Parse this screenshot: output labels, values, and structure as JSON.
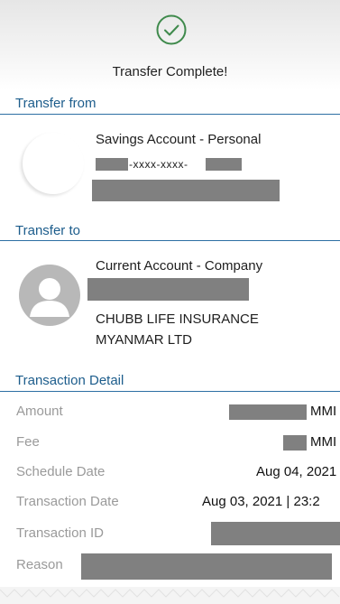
{
  "header": {
    "status_icon": "check-circle-icon",
    "title": "Transfer Complete!",
    "accent_color": "#3f8a4c"
  },
  "transfer_from": {
    "section_title": "Transfer from",
    "account_name": "Savings Account - Personal",
    "account_number_masked": "-xxxx-xxxx-"
  },
  "transfer_to": {
    "section_title": "Transfer to",
    "account_type": "Current Account - Company",
    "payee_name_line1": "CHUBB LIFE INSURANCE",
    "payee_name_line2": "MYANMAR LTD"
  },
  "transaction_detail": {
    "section_title": "Transaction Detail",
    "rows": [
      {
        "label": "Amount",
        "value": "MMI"
      },
      {
        "label": "Fee",
        "value": "MMI"
      },
      {
        "label": "Schedule Date",
        "value": "Aug 04, 2021"
      },
      {
        "label": "Transaction Date",
        "value": "Aug 03, 2021 | 23:2"
      },
      {
        "label": "Transaction ID",
        "value": ""
      },
      {
        "label": "Reason",
        "value": ""
      }
    ]
  },
  "colors": {
    "section_title": "#1d5d8c",
    "section_line": "#2d6fa3",
    "label_gray": "#9a9a9a",
    "redaction": "#808080"
  }
}
